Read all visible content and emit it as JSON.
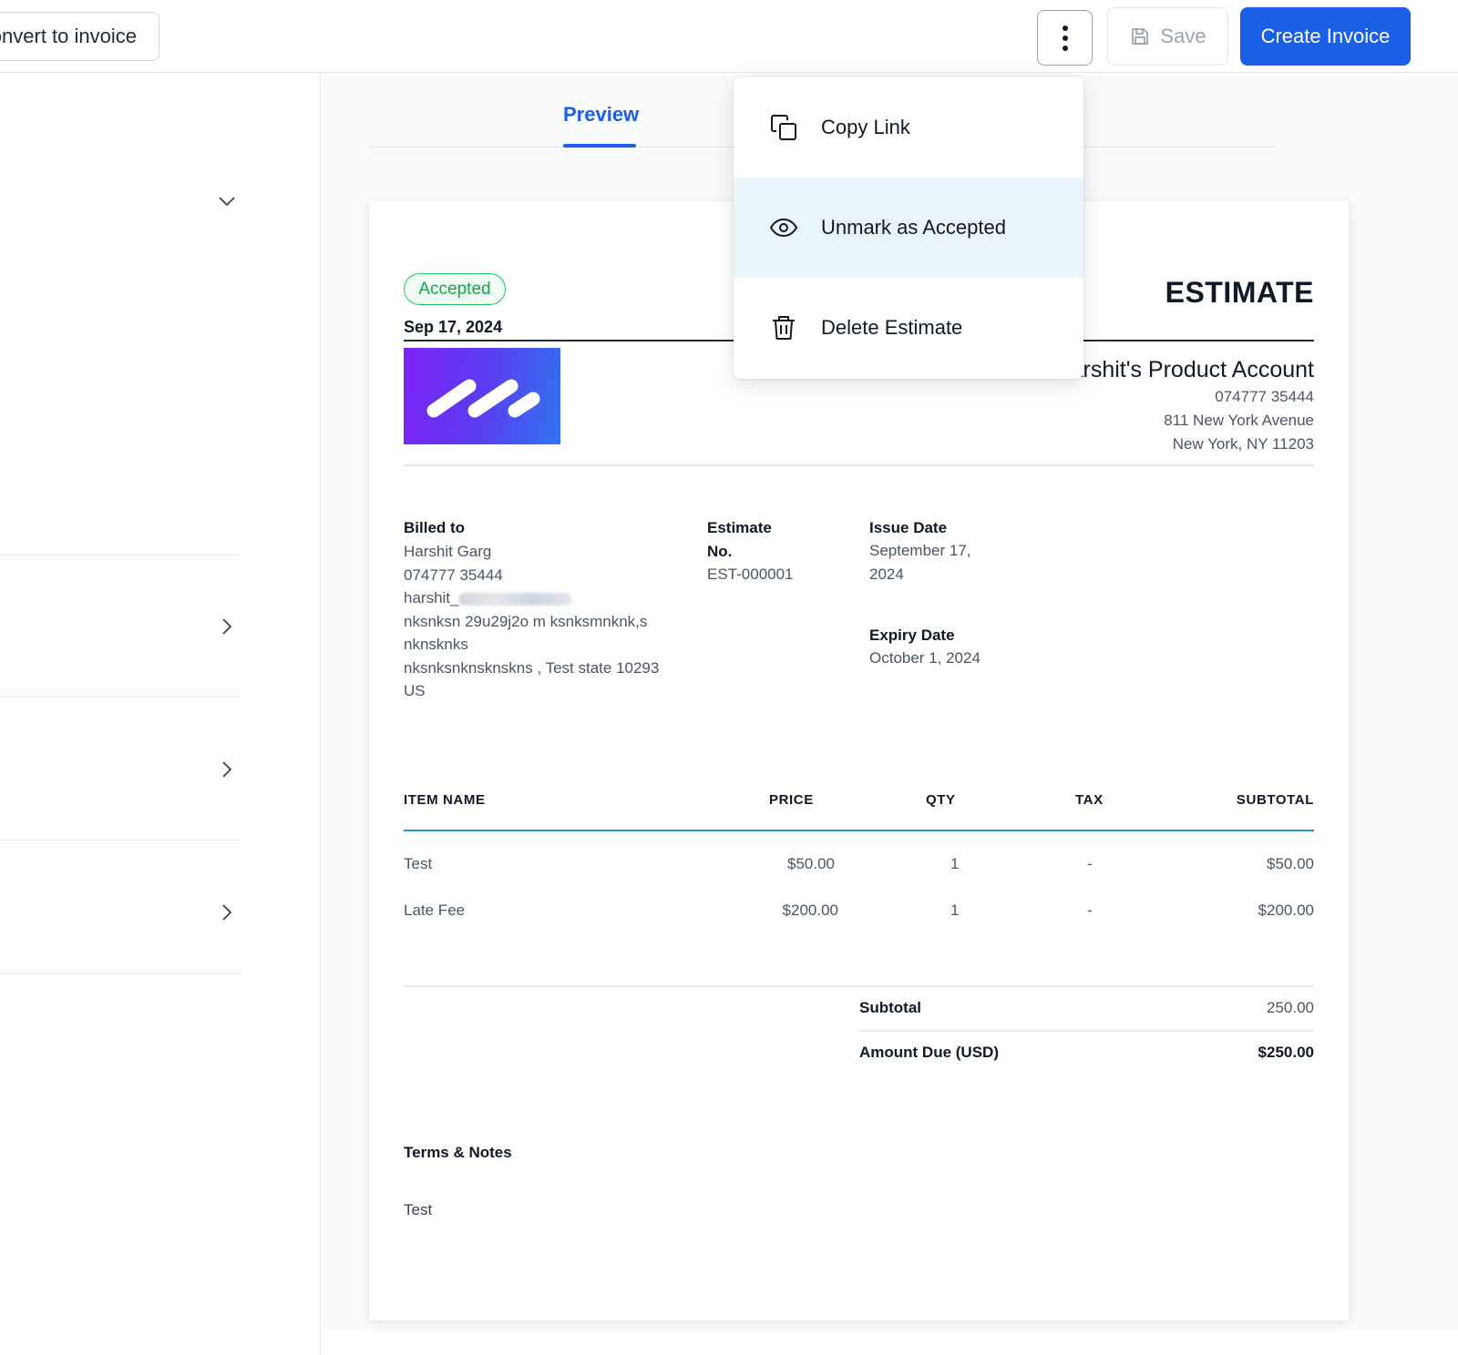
{
  "toolbar": {
    "convert_label": "Convert to invoice",
    "save_label": "Save",
    "create_label": "Create Invoice"
  },
  "tabs": {
    "preview_label": "Preview"
  },
  "menu": {
    "items": [
      {
        "label": "Copy Link",
        "icon": "copy-icon"
      },
      {
        "label": "Unmark as Accepted",
        "icon": "eye-icon"
      },
      {
        "label": "Delete Estimate",
        "icon": "trash-icon"
      }
    ]
  },
  "document": {
    "status": "Accepted",
    "date": "Sep 17, 2024",
    "title": "ESTIMATE",
    "company": {
      "name": "Harshit's Product Account",
      "phone": "074777 35444",
      "street": "811 New York Avenue",
      "city": "New York, NY 11203"
    },
    "billed_to": {
      "label": "Billed to",
      "name": "Harshit Garg",
      "phone": "074777 35444",
      "email_prefix": "harshit_",
      "address1": "nksnksn 29u29j2o m ksnksmnknk,s",
      "address2": "nknsknks",
      "address3": "nksnksnknsknskns , Test state 10293",
      "country": "US"
    },
    "estimate_no": {
      "label_line1": "Estimate",
      "label_line2": "No.",
      "value": "EST-000001"
    },
    "issue_date": {
      "label": "Issue Date",
      "value_line1": "September 17,",
      "value_line2": "2024"
    },
    "expiry_date": {
      "label": "Expiry Date",
      "value": "October 1, 2024"
    },
    "table": {
      "headers": {
        "item": "ITEM NAME",
        "price": "PRICE",
        "qty": "QTY",
        "tax": "TAX",
        "subtotal": "SUBTOTAL"
      },
      "rows": [
        {
          "item": "Test",
          "price": "$50.00",
          "qty": "1",
          "tax": "-",
          "subtotal": "$50.00"
        },
        {
          "item": "Late Fee",
          "price": "$200.00",
          "qty": "1",
          "tax": "-",
          "subtotal": "$200.00"
        }
      ]
    },
    "totals": {
      "subtotal_label": "Subtotal",
      "subtotal_value": "250.00",
      "amount_due_label": "Amount Due (USD)",
      "amount_due_value": "$250.00"
    },
    "terms": {
      "label": "Terms & Notes",
      "text": "Test"
    }
  },
  "colors": {
    "primary": "#1a5fe6",
    "accepted": "#16a34a",
    "table_rule": "#2a93c9",
    "menu_active": "#eaf5fb"
  }
}
